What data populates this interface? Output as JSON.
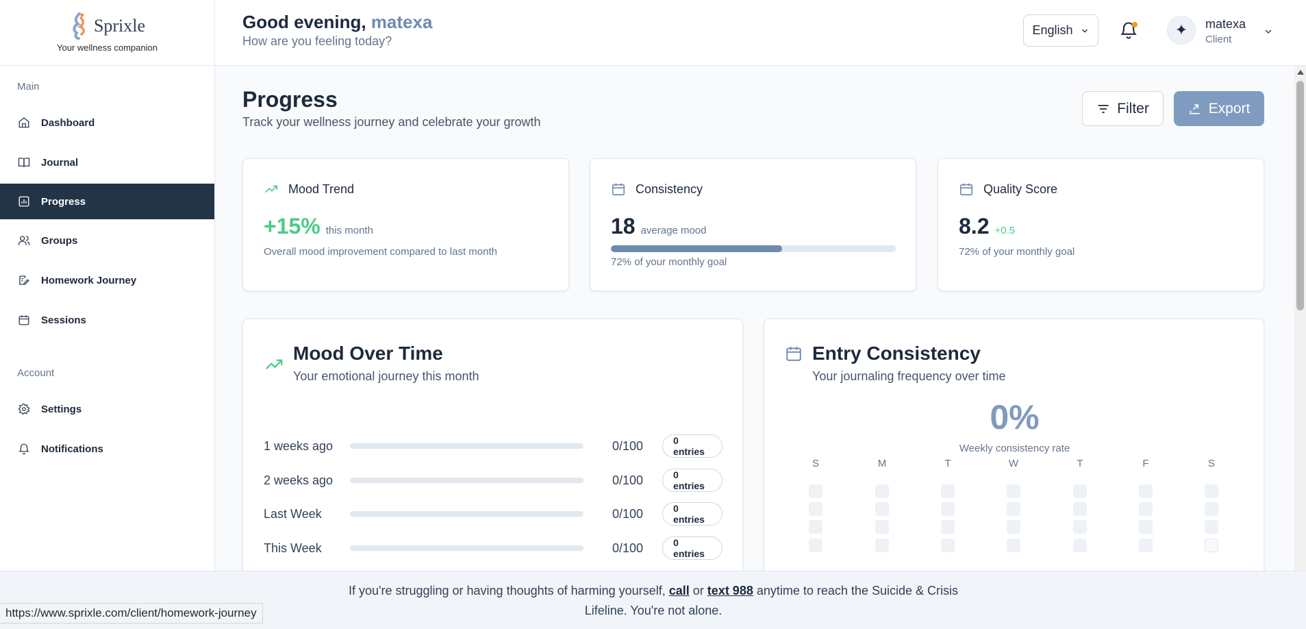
{
  "brand": {
    "name": "Sprixle",
    "tagline": "Your wellness companion"
  },
  "sidebar": {
    "main_label": "Main",
    "account_label": "Account",
    "items": [
      {
        "label": "Dashboard",
        "icon": "home-icon"
      },
      {
        "label": "Journal",
        "icon": "book-icon"
      },
      {
        "label": "Progress",
        "icon": "chart-icon",
        "active": true
      },
      {
        "label": "Groups",
        "icon": "users-icon"
      },
      {
        "label": "Homework Journey",
        "icon": "edit-icon"
      },
      {
        "label": "Sessions",
        "icon": "calendar-icon"
      }
    ],
    "account_items": [
      {
        "label": "Settings",
        "icon": "gear-icon"
      },
      {
        "label": "Notifications",
        "icon": "bell-icon"
      }
    ]
  },
  "header": {
    "greeting": "Good evening,",
    "username": "matexa",
    "subtitle": "How are you feeling today?",
    "language": "English",
    "user_name": "matexa",
    "user_role": "Client",
    "avatar_glyph": "✦"
  },
  "page": {
    "title": "Progress",
    "subtitle": "Track your wellness journey and celebrate your growth",
    "filter_label": "Filter",
    "export_label": "Export"
  },
  "stats": {
    "mood": {
      "title": "Mood Trend",
      "value": "+15%",
      "unit": "this month",
      "note": "Overall mood improvement compared to last month"
    },
    "consistency": {
      "title": "Consistency",
      "value": "18",
      "unit": "average mood",
      "progress": 0.6,
      "note": "72% of your monthly goal"
    },
    "quality": {
      "title": "Quality Score",
      "value": "8.2",
      "delta": "+0.5",
      "note": "72% of your monthly goal"
    }
  },
  "mood_over_time": {
    "title": "Mood Over Time",
    "subtitle": "Your emotional journey this month",
    "rows": [
      {
        "label": "1 weeks ago",
        "score": "0/100",
        "value": 0,
        "entries": "0 entries"
      },
      {
        "label": "2 weeks ago",
        "score": "0/100",
        "value": 0,
        "entries": "0 entries"
      },
      {
        "label": "Last Week",
        "score": "0/100",
        "value": 0,
        "entries": "0 entries"
      },
      {
        "label": "This Week",
        "score": "0/100",
        "value": 0,
        "entries": "0 entries"
      }
    ]
  },
  "entry_consistency": {
    "title": "Entry Consistency",
    "subtitle": "Your journaling frequency over time",
    "rate": "0%",
    "rate_label": "Weekly consistency rate",
    "weekdays": [
      "S",
      "M",
      "T",
      "W",
      "T",
      "F",
      "S"
    ]
  },
  "crisis": {
    "before": "If you're struggling or having thoughts of harming yourself,",
    "call": "call",
    "or": "or",
    "text988": "text 988",
    "after": "anytime to reach the Suicide & Crisis Lifeline. You're not alone."
  },
  "status_url": "https://www.sprixle.com/client/homework-journey",
  "colors": {
    "accent": "#6e8bb0",
    "sidebar_active": "#243447",
    "green": "#4ccb86",
    "export": "#7f9bbf"
  }
}
